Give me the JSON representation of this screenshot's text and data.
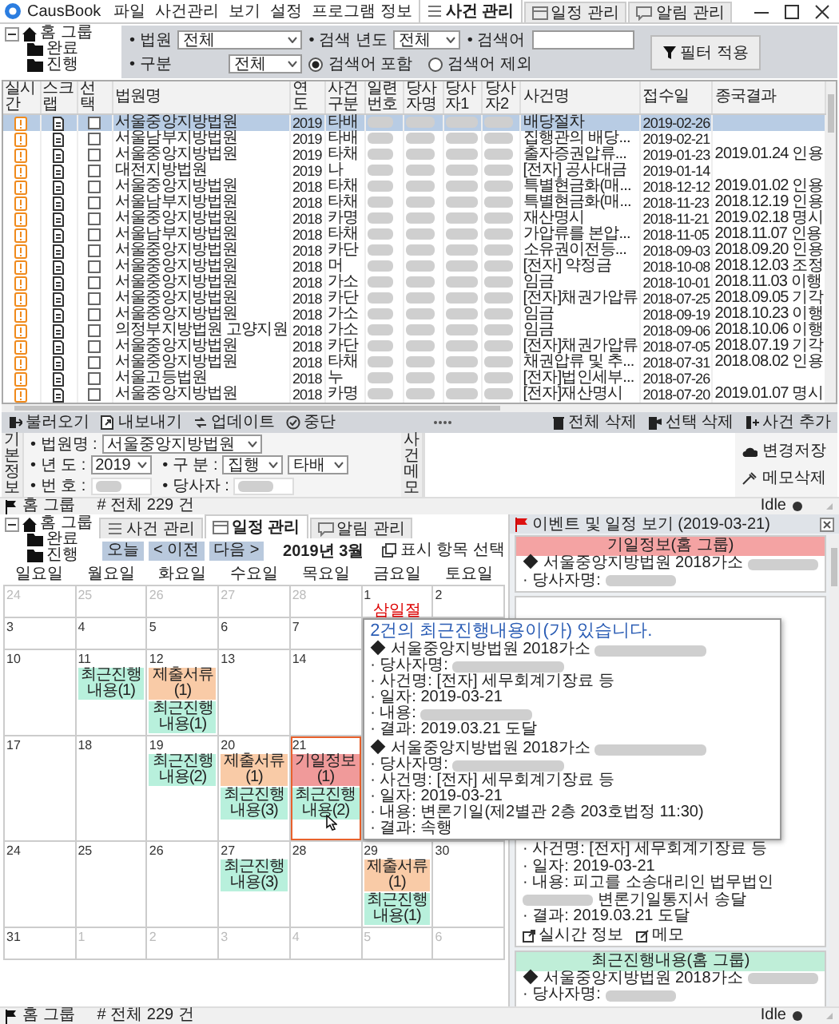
{
  "window": {
    "title": "CausBook"
  },
  "menu": [
    "파일",
    "사건관리",
    "보기",
    "설정",
    "프로그램 정보"
  ],
  "case_view": {
    "tree": {
      "label": "홈 그룹",
      "expanded": true,
      "children": [
        {
          "label": "완료"
        },
        {
          "label": "진행"
        }
      ]
    },
    "tabs": [
      {
        "label": "사건 관리",
        "selected": true
      },
      {
        "label": "일정 관리",
        "selected": false
      },
      {
        "label": "알림 관리",
        "selected": false
      }
    ],
    "filter": {
      "court": {
        "label": "• 법원",
        "value": "전체"
      },
      "year": {
        "label": "• 검색 년도",
        "value": "전체"
      },
      "keyword": {
        "label": "• 검색어"
      },
      "category": {
        "label": "• 구분",
        "value": "전체"
      },
      "radios": [
        {
          "label": "검색어 포함",
          "selected": true
        },
        {
          "label": "검색어 제외",
          "selected": false
        }
      ],
      "apply_button": "필터 적용"
    },
    "table": {
      "columns": [
        {
          "label": "실시간",
          "kind": "live"
        },
        {
          "label": "스크랩",
          "kind": "scrap"
        },
        {
          "label": "선택",
          "kind": "check"
        },
        {
          "label": "법원명",
          "kind": "court"
        },
        {
          "label": "연도",
          "kind": "year"
        },
        {
          "label": "사건구분",
          "kind": "type"
        },
        {
          "label": "일련번호",
          "kind": "blurred"
        },
        {
          "label": "당사자명",
          "kind": "blurred"
        },
        {
          "label": "당사자1",
          "kind": "blurred"
        },
        {
          "label": "당사자2",
          "kind": "blurred"
        },
        {
          "label": "사건명",
          "kind": "case_name"
        },
        {
          "label": "접수일",
          "kind": "received"
        },
        {
          "label": "종국결과",
          "kind": "result"
        }
      ],
      "rows": [
        {
          "selected": true,
          "checked": false,
          "court": "서울중앙지방법원",
          "year": "2019",
          "type": "타배",
          "case_name": "배당절차",
          "received": "2019-02-26"
        },
        {
          "selected": false,
          "checked": false,
          "court": "서울남부지방법원",
          "year": "2019",
          "type": "타배",
          "case_name": "집행관의 배당...",
          "received": "2019-02-21"
        },
        {
          "selected": false,
          "checked": false,
          "court": "서울중앙지방법원",
          "year": "2019",
          "type": "타채",
          "case_name": "출자증권압류...",
          "received": "2019-01-23",
          "result": "2019.01.24 인용"
        },
        {
          "selected": false,
          "checked": false,
          "court": "대전지방법원",
          "year": "2019",
          "type": "나",
          "case_name": "[전자]  공사대금",
          "received": "2019-01-14"
        },
        {
          "selected": false,
          "checked": false,
          "court": "서울중앙지방법원",
          "year": "2018",
          "type": "타채",
          "case_name": "특별현금화(매...",
          "received": "2018-12-12",
          "result": "2019.01.02 인용"
        },
        {
          "selected": false,
          "checked": false,
          "court": "서울남부지방법원",
          "year": "2018",
          "type": "타채",
          "case_name": "특별현금화(매...",
          "received": "2018-11-23",
          "result": "2018.12.19 인용"
        },
        {
          "selected": false,
          "checked": false,
          "court": "서울중앙지방법원",
          "year": "2018",
          "type": "카명",
          "case_name": "재산명시",
          "received": "2018-11-21",
          "result": "2019.02.18 명시"
        },
        {
          "selected": false,
          "checked": false,
          "court": "서울남부지방법원",
          "year": "2018",
          "type": "타채",
          "case_name": "가압류를 본압...",
          "received": "2018-11-05",
          "result": "2018.11.07 인용"
        },
        {
          "selected": false,
          "checked": false,
          "court": "서울중앙지방법원",
          "year": "2018",
          "type": "카단",
          "case_name": "소유권이전등...",
          "received": "2018-09-03",
          "result": "2018.09.20 인용"
        },
        {
          "selected": false,
          "checked": false,
          "court": "서울중앙지방법원",
          "year": "2018",
          "type": "머",
          "case_name": "[전자]  약정금",
          "received": "2018-10-08",
          "result": "2018.12.03 조정"
        },
        {
          "selected": false,
          "checked": false,
          "court": "서울중앙지방법원",
          "year": "2018",
          "type": "가소",
          "case_name": "임금",
          "received": "2018-10-01",
          "result": "2018.11.03 이행"
        },
        {
          "selected": false,
          "checked": false,
          "court": "서울중앙지방법원",
          "year": "2018",
          "type": "카단",
          "case_name": "[전자]채권가압류",
          "received": "2018-07-25",
          "result": "2018.09.05 기각"
        },
        {
          "selected": false,
          "checked": false,
          "court": "서울중앙지방법원",
          "year": "2018",
          "type": "가소",
          "case_name": "임금",
          "received": "2018-09-19",
          "result": "2018.10.23 이행"
        },
        {
          "selected": false,
          "checked": false,
          "court": "의정부지방법원 고양지원",
          "year": "2018",
          "type": "가소",
          "case_name": "임금",
          "received": "2018-09-06",
          "result": "2018.10.06 이행"
        },
        {
          "selected": false,
          "checked": false,
          "court": "서울중앙지방법원",
          "year": "2018",
          "type": "카단",
          "case_name": "[전자]채권가압류",
          "received": "2018-07-05",
          "result": "2018.07.19 기각"
        },
        {
          "selected": false,
          "checked": false,
          "court": "서울중앙지방법원",
          "year": "2018",
          "type": "타채",
          "case_name": "채권압류 및 추...",
          "received": "2018-07-31",
          "result": "2018.08.02 인용"
        },
        {
          "selected": false,
          "checked": false,
          "court": "서울고등법원",
          "year": "2018",
          "type": "누",
          "case_name": "[전자]법인세부...",
          "received": "2018-07-26"
        },
        {
          "selected": false,
          "checked": false,
          "court": "서울중앙지방법원",
          "year": "2018",
          "type": "카명",
          "case_name": "[전자]재산명시",
          "received": "2018-07-20",
          "result": "2019.01.07 명시"
        }
      ]
    },
    "toolbar_left": [
      "불러오기",
      "내보내기",
      "업데이트",
      "중단"
    ],
    "toolbar_right": [
      "전체 삭제",
      "선택 삭제",
      "사건 추가"
    ],
    "detail": {
      "info_title": "기본정보",
      "court": {
        "label": "• 법원명 :",
        "value": "서울중앙지방법원"
      },
      "year": {
        "label": "• 년   도 :",
        "value": "2019"
      },
      "category": {
        "label": "• 구   분 :",
        "values": [
          "집행",
          "타배"
        ]
      },
      "number": {
        "label": "• 번   호 :"
      },
      "party": {
        "label": "• 당사자 :"
      },
      "memo_title": "사건메모",
      "buttons": [
        "변경저장",
        "메모삭제"
      ]
    },
    "status_bar": {
      "group": "홈 그룹",
      "count": "# 전체 229 건",
      "state": "Idle"
    }
  },
  "schedule_view": {
    "tree": {
      "label": "홈 그룹",
      "expanded": true,
      "children": [
        {
          "label": "완료"
        },
        {
          "label": "진행"
        }
      ]
    },
    "tabs": [
      {
        "label": "사건 관리",
        "selected": false
      },
      {
        "label": "일정 관리",
        "selected": true
      },
      {
        "label": "알림 관리",
        "selected": false
      }
    ],
    "nav": [
      "오늘",
      "< 이전",
      "다음 >"
    ],
    "month": "2019년 3월",
    "display_button": "표시 항목 선택",
    "weekdays": [
      "일요일",
      "월요일",
      "화요일",
      "수요일",
      "목요일",
      "금요일",
      "토요일"
    ],
    "weeks": [
      [
        {
          "day": "24",
          "other": true,
          "selected": false
        },
        {
          "day": "25",
          "other": true,
          "selected": false
        },
        {
          "day": "26",
          "other": true,
          "selected": false
        },
        {
          "day": "27",
          "other": true,
          "selected": false
        },
        {
          "day": "28",
          "other": true,
          "selected": false
        },
        {
          "day": "1",
          "other": false,
          "selected": false,
          "events": [
            {
              "label": "삼일절",
              "kind": "holiday"
            }
          ]
        },
        {
          "day": "2",
          "other": false,
          "selected": false
        }
      ],
      [
        {
          "day": "3",
          "other": false,
          "selected": false
        },
        {
          "day": "4",
          "other": false,
          "selected": false
        },
        {
          "day": "5",
          "other": false,
          "selected": false
        },
        {
          "day": "6",
          "other": false,
          "selected": false
        },
        {
          "day": "7",
          "other": false,
          "selected": false
        }
      ],
      [
        {
          "day": "10",
          "other": false,
          "selected": false
        },
        {
          "day": "11",
          "other": false,
          "selected": false,
          "events": [
            {
              "label": "최근진행내용(1)",
              "kind": "chip",
              "color": "#b8f0dc"
            }
          ]
        },
        {
          "day": "12",
          "other": false,
          "selected": false,
          "events": [
            {
              "label": "제출서류(1)",
              "kind": "chip",
              "color": "#f9cba7"
            },
            {
              "label": "최근진행내용(1)",
              "kind": "chip",
              "color": "#b8f0dc"
            }
          ]
        },
        {
          "day": "13",
          "other": false,
          "selected": false
        },
        {
          "day": "14",
          "other": false,
          "selected": false
        }
      ],
      [
        {
          "day": "17",
          "other": false,
          "selected": false
        },
        {
          "day": "18",
          "other": false,
          "selected": false
        },
        {
          "day": "19",
          "other": false,
          "selected": false,
          "events": [
            {
              "label": "최근진행내용(2)",
              "kind": "chip",
              "color": "#b8f0dc"
            }
          ]
        },
        {
          "day": "20",
          "other": false,
          "selected": false,
          "events": [
            {
              "label": "제출서류(1)",
              "kind": "chip",
              "color": "#f9cba7"
            },
            {
              "label": "최근진행내용(3)",
              "kind": "chip",
              "color": "#b8f0dc"
            }
          ]
        },
        {
          "day": "21",
          "other": false,
          "selected": true,
          "events": [
            {
              "label": "기일정보(1)",
              "kind": "chip",
              "color": "#f09a9a"
            },
            {
              "label": "최근진행내용(2)",
              "kind": "chip",
              "color": "#b8f0dc"
            }
          ]
        }
      ],
      [
        {
          "day": "24",
          "other": false,
          "selected": false
        },
        {
          "day": "25",
          "other": false,
          "selected": false
        },
        {
          "day": "26",
          "other": false,
          "selected": false
        },
        {
          "day": "27",
          "other": false,
          "selected": false,
          "events": [
            {
              "label": "최근진행내용(3)",
              "kind": "chip",
              "color": "#b8f0dc"
            }
          ]
        },
        {
          "day": "28",
          "other": false,
          "selected": false
        },
        {
          "day": "29",
          "other": false,
          "selected": false,
          "events": [
            {
              "label": "제출서류(1)",
              "kind": "chip",
              "color": "#f9cba7"
            },
            {
              "label": "최근진행내용(1)",
              "kind": "chip",
              "color": "#b8f0dc"
            }
          ]
        },
        {
          "day": "30",
          "other": false,
          "selected": false
        }
      ],
      [
        {
          "day": "31",
          "other": false,
          "selected": false
        },
        {
          "day": "1",
          "other": true,
          "selected": false
        },
        {
          "day": "2",
          "other": true,
          "selected": false
        },
        {
          "day": "3",
          "other": true,
          "selected": false
        },
        {
          "day": "4",
          "other": true,
          "selected": false
        },
        {
          "day": "5",
          "other": true,
          "selected": false
        },
        {
          "day": "6",
          "other": true,
          "selected": false
        }
      ]
    ],
    "tooltip": {
      "title": "2건의 최근진행내용이(가) 있습니다.",
      "entries": [
        {
          "lines": [
            {
              "text": "◆ 서울중앙지방법원 2018가소",
              "redacted": true
            },
            {
              "text": "· 당사자명:",
              "redacted": true
            },
            {
              "text": "· 사건명: [전자]  세무회계기장료 등"
            },
            {
              "text": "· 일자: 2019-03-21"
            },
            {
              "text": "· 내용:",
              "redacted": true
            },
            {
              "text": "· 결과: 2019.03.21 도달"
            }
          ]
        },
        {
          "lines": [
            {
              "text": "◆ 서울중앙지방법원 2018가소",
              "redacted": true
            },
            {
              "text": "· 당사자명:",
              "redacted": true
            },
            {
              "text": "· 사건명: [전자]  세무회계기장료 등"
            },
            {
              "text": "· 일자: 2019-03-21"
            },
            {
              "text": "· 내용: 변론기일(제2별관 2층 203호법정 11:30)"
            },
            {
              "text": "· 결과: 속행"
            }
          ]
        }
      ]
    },
    "panel": {
      "title": "이벤트 및 일정 보기 (2019-03-21)",
      "cards": [
        {
          "title": "기일정보(홈 그룹)",
          "color": "#f4a3a3",
          "lines": [
            {
              "text": "◆ 서울중앙지방법원 2018가소",
              "redacted": true
            },
            {
              "text": "· 당사자명:",
              "redacted": true
            }
          ]
        },
        {
          "lines": [
            {
              "text": "· 사건명: [전자]  세무회계기장료 등"
            },
            {
              "text": "· 일자: 2019-03-21"
            },
            {
              "text": "· 내용: 피고를 소송대리인 법무법인",
              "redacted": true,
              "text_after": "변론기일통지서 송달"
            },
            {
              "text": "· 결과: 2019.03.21 도달"
            }
          ],
          "links": [
            "실시간 정보",
            "메모"
          ]
        },
        {
          "title": "최근진행내용(홈 그룹)",
          "color": "#bfeed8",
          "lines": [
            {
              "text": "◆ 서울중앙지방법원 2018가소",
              "redacted": true
            },
            {
              "text": "· 당사자명:",
              "redacted": true
            }
          ]
        }
      ]
    },
    "status_bar": {
      "group": "홈 그룹",
      "count": "# 전체 229 건",
      "state": "Idle"
    }
  }
}
